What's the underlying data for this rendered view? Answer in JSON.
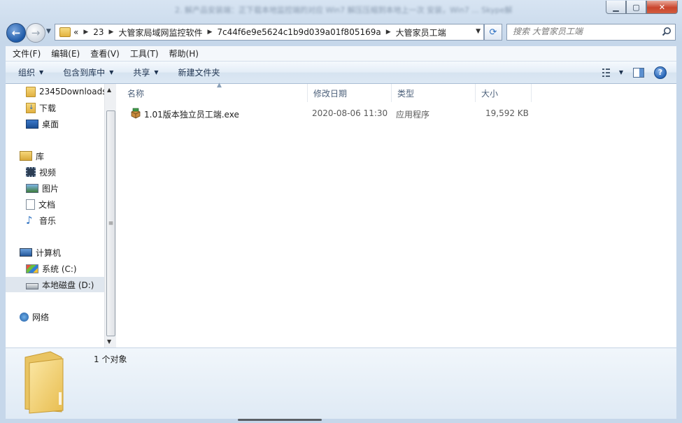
{
  "window": {
    "ghost_title": "2. 解产品安装端：正下载本地监控端的对应 Win7 解压压缩到本地上一次 安装，Win7 ... Skype解"
  },
  "address": {
    "prefix": "«",
    "crumbs": [
      "23",
      "大管家局域网监控软件",
      "7c44f6e9e5624c1b9d039a01f805169a",
      "大管家员工端"
    ]
  },
  "search": {
    "placeholder": "搜索 大管家员工端"
  },
  "menu": [
    "文件(F)",
    "编辑(E)",
    "查看(V)",
    "工具(T)",
    "帮助(H)"
  ],
  "toolbar": {
    "organize": "组织",
    "include_library": "包含到库中",
    "share": "共享",
    "new_folder": "新建文件夹"
  },
  "nav": {
    "items": [
      {
        "label": "2345Downloads",
        "icon": "folder-icon"
      },
      {
        "label": "下载",
        "icon": "downloads-icon"
      },
      {
        "label": "桌面",
        "icon": "desktop-icon"
      },
      {
        "label": "库",
        "icon": "library-icon"
      },
      {
        "label": "视频",
        "icon": "video-icon"
      },
      {
        "label": "图片",
        "icon": "pictures-icon"
      },
      {
        "label": "文档",
        "icon": "documents-icon"
      },
      {
        "label": "音乐",
        "icon": "music-icon"
      },
      {
        "label": "计算机",
        "icon": "computer-icon"
      },
      {
        "label": "系统 (C:)",
        "icon": "system-drive-icon"
      },
      {
        "label": "本地磁盘 (D:)",
        "icon": "local-disk-icon",
        "selected": true
      },
      {
        "label": "网络",
        "icon": "network-icon"
      }
    ]
  },
  "columns": {
    "name": "名称",
    "modified": "修改日期",
    "type": "类型",
    "size": "大小"
  },
  "files": [
    {
      "name": "1.01版本独立员工端.exe",
      "modified": "2020-08-06 11:30",
      "type": "应用程序",
      "size": "19,592 KB"
    }
  ],
  "details": {
    "count": "1 个对象"
  },
  "colors": {
    "accent": "#1e5aa8",
    "selected": "#dfe6ee"
  }
}
